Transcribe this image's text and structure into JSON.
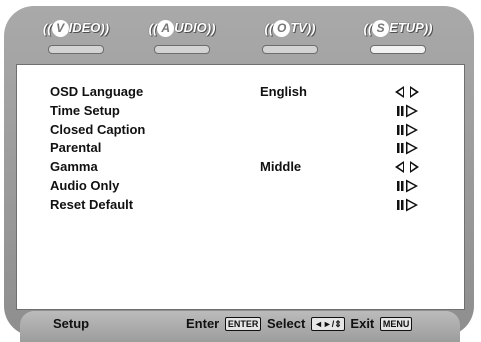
{
  "tabs": [
    {
      "open": "((",
      "letter": "V",
      "rest": "IDEO",
      "close": "))",
      "active": false
    },
    {
      "open": "((",
      "letter": "A",
      "rest": "UDIO",
      "close": "))",
      "active": false
    },
    {
      "open": "((",
      "letter": "O",
      "rest": "TV",
      "close": "))",
      "active": false
    },
    {
      "open": "((",
      "letter": "S",
      "rest": "ETUP",
      "close": "))",
      "active": true
    }
  ],
  "menu": [
    {
      "label": "OSD Language",
      "value": "English",
      "arrow": "double"
    },
    {
      "label": "Time Setup",
      "value": "",
      "arrow": "submenu"
    },
    {
      "label": "Closed Caption",
      "value": "",
      "arrow": "submenu"
    },
    {
      "label": "Parental",
      "value": "",
      "arrow": "submenu"
    },
    {
      "label": "Gamma",
      "value": "Middle",
      "arrow": "double"
    },
    {
      "label": "Audio Only",
      "value": "",
      "arrow": "submenu"
    },
    {
      "label": "Reset Default",
      "value": "",
      "arrow": "submenu"
    }
  ],
  "footer": {
    "title": "Setup",
    "enter_label": "Enter",
    "enter_key": "ENTER",
    "select_label": "Select",
    "select_key": "◄►/⇕",
    "exit_label": "Exit",
    "exit_key": "MENU"
  }
}
